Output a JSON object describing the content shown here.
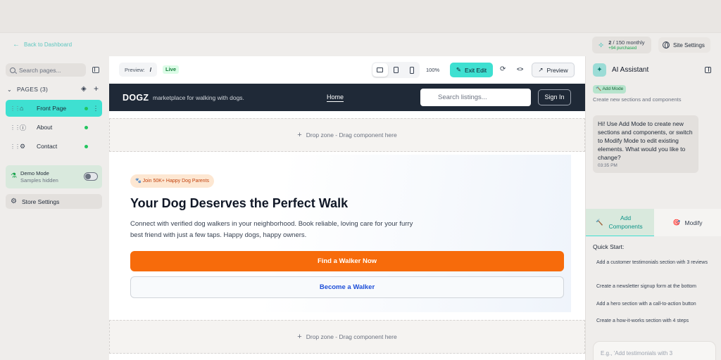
{
  "appbar": {
    "back_label": "Back to Dashboard",
    "usage_count": "2",
    "usage_suffix": "/ 150 monthly",
    "usage_purchased": "+94 purchased",
    "site_settings_label": "Site Settings"
  },
  "sidebar": {
    "search_placeholder": "Search pages...",
    "pages_header": "PAGES (3)",
    "pages": [
      {
        "label": "Front Page",
        "icon": "home-icon"
      },
      {
        "label": "About",
        "icon": "info-icon"
      },
      {
        "label": "Contact",
        "icon": "gear-icon"
      }
    ],
    "demo_title": "Demo Mode",
    "demo_subtitle": "Samples hidden",
    "store_settings_label": "Store Settings"
  },
  "toolbar": {
    "preview_label": "Preview:",
    "preview_path": "/",
    "live_label": "Live",
    "zoom": "100%",
    "exit_edit_label": "Exit Edit",
    "preview_button_label": "Preview"
  },
  "site": {
    "brand": "DOGZ",
    "tagline": "marketplace for walking with dogs.",
    "nav_home": "Home",
    "search_placeholder": "Search listings...",
    "signin_label": "Sign In",
    "dropzone_label": "Drop zone - Drag component here",
    "hero": {
      "badge": "🐾 Join 50K+ Happy Dog Parents",
      "title": "Your Dog Deserves the Perfect Walk",
      "description": "Connect with verified dog walkers in your neighborhood. Book reliable, loving care for your furry best friend with just a few taps. Happy dogs, happy owners.",
      "primary_cta": "Find a Walker Now",
      "secondary_cta": "Become a Walker"
    }
  },
  "ai": {
    "title": "AI Assistant",
    "mode_badge": "Add Mode",
    "mode_desc": "Create new sections and components",
    "message": "Hi! Use Add Mode to create new sections and components, or switch to Modify Mode to edit existing elements. What would you like to change?",
    "message_time": "03:35 PM",
    "tab_add": "Add Components",
    "tab_modify": "Modify",
    "quick_start_title": "Quick Start:",
    "quick_start": [
      "Add a customer testimonials section with 3 reviews",
      "Create a newsletter signup form at the bottom",
      "Add a hero section with a call-to-action button",
      "Create a how-it-works section with 4 steps"
    ],
    "input_placeholder": "E.g., 'Add testimonials with 3"
  },
  "colors": {
    "accent": "#3ee0d1",
    "nav_bg": "#1f2937",
    "cta_orange": "#f76b0b",
    "live_green": "#22c55e"
  }
}
